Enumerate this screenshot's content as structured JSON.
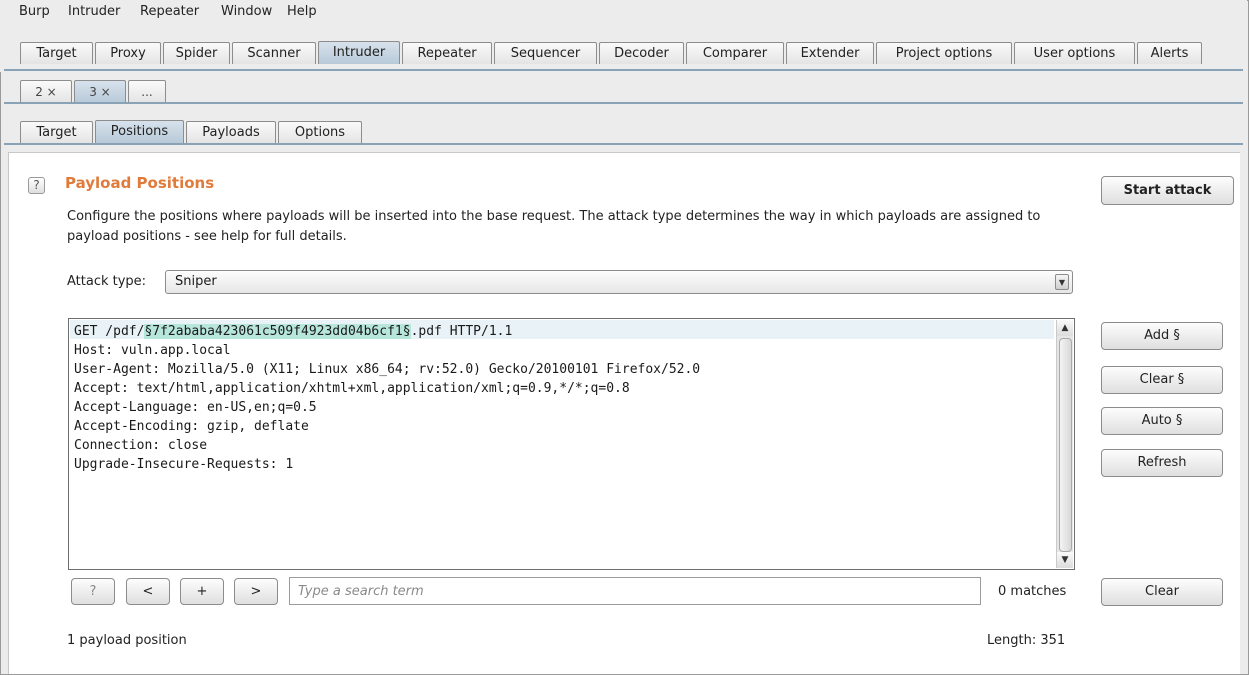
{
  "menubar": [
    "Burp",
    "Intruder",
    "Repeater",
    "Window",
    "Help"
  ],
  "main_tabs": [
    "Target",
    "Proxy",
    "Spider",
    "Scanner",
    "Intruder",
    "Repeater",
    "Sequencer",
    "Decoder",
    "Comparer",
    "Extender",
    "Project options",
    "User options",
    "Alerts"
  ],
  "main_tabs_active": "Intruder",
  "attack_tabs": [
    "2 ×",
    "3 ×",
    "..."
  ],
  "sub_tabs": [
    "Target",
    "Positions",
    "Payloads",
    "Options"
  ],
  "sub_tabs_active": "Positions",
  "section": {
    "help": "?",
    "title": "Payload Positions",
    "description": "Configure the positions where payloads will be inserted into the base request. The attack type determines the way in which payloads are assigned to payload positions - see help for full details.",
    "start_attack": "Start attack"
  },
  "attack_type": {
    "label": "Attack type:",
    "value": "Sniper"
  },
  "request": {
    "line1_prefix": "GET /pdf/",
    "line1_payload": "§7f2ababa423061c509f4923dd04b6cf1§",
    "line1_suffix": ".pdf HTTP/1.1",
    "lines": [
      "Host: vuln.app.local",
      "User-Agent: Mozilla/5.0 (X11; Linux x86_64; rv:52.0) Gecko/20100101 Firefox/52.0",
      "Accept: text/html,application/xhtml+xml,application/xml;q=0.9,*/*;q=0.8",
      "Accept-Language: en-US,en;q=0.5",
      "Accept-Encoding: gzip, deflate",
      "Connection: close",
      "Upgrade-Insecure-Requests: 1"
    ]
  },
  "side_buttons": {
    "add": "Add §",
    "clear": "Clear §",
    "auto": "Auto §",
    "refresh": "Refresh"
  },
  "search_bar": {
    "help": "?",
    "prev": "<",
    "plus": "+",
    "next": ">",
    "placeholder": "Type a search term",
    "matches": "0 matches",
    "clear": "Clear"
  },
  "footer": {
    "positions": "1 payload position",
    "length": "Length: 351"
  },
  "colors": {
    "title": "#e07b3c",
    "payload_highlight": "#b7e6da",
    "active_tab": "#c3d2df"
  }
}
